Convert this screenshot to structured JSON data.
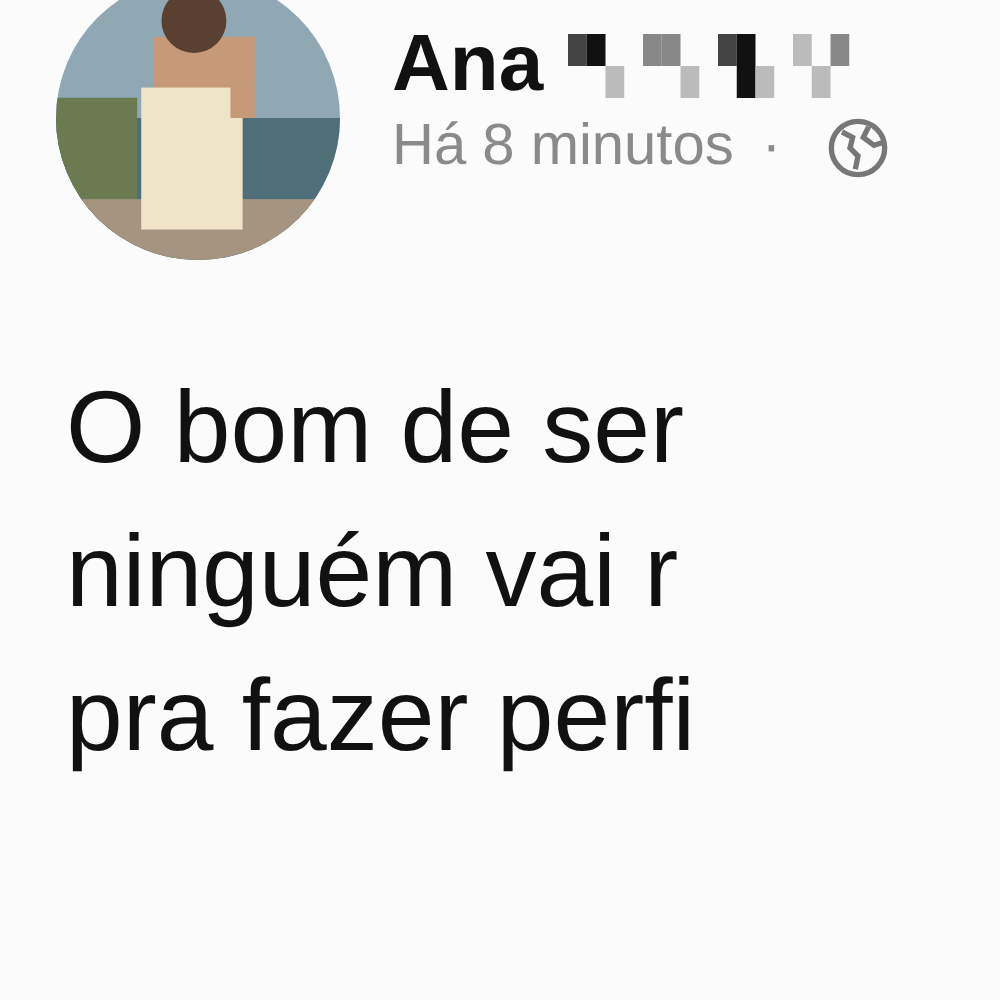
{
  "post": {
    "author": {
      "name": "Ana"
    },
    "time": "Há 8 minutos",
    "separator": "·",
    "body_lines": [
      "O bom de ser",
      "ninguém vai r",
      "pra fazer perfi"
    ]
  }
}
